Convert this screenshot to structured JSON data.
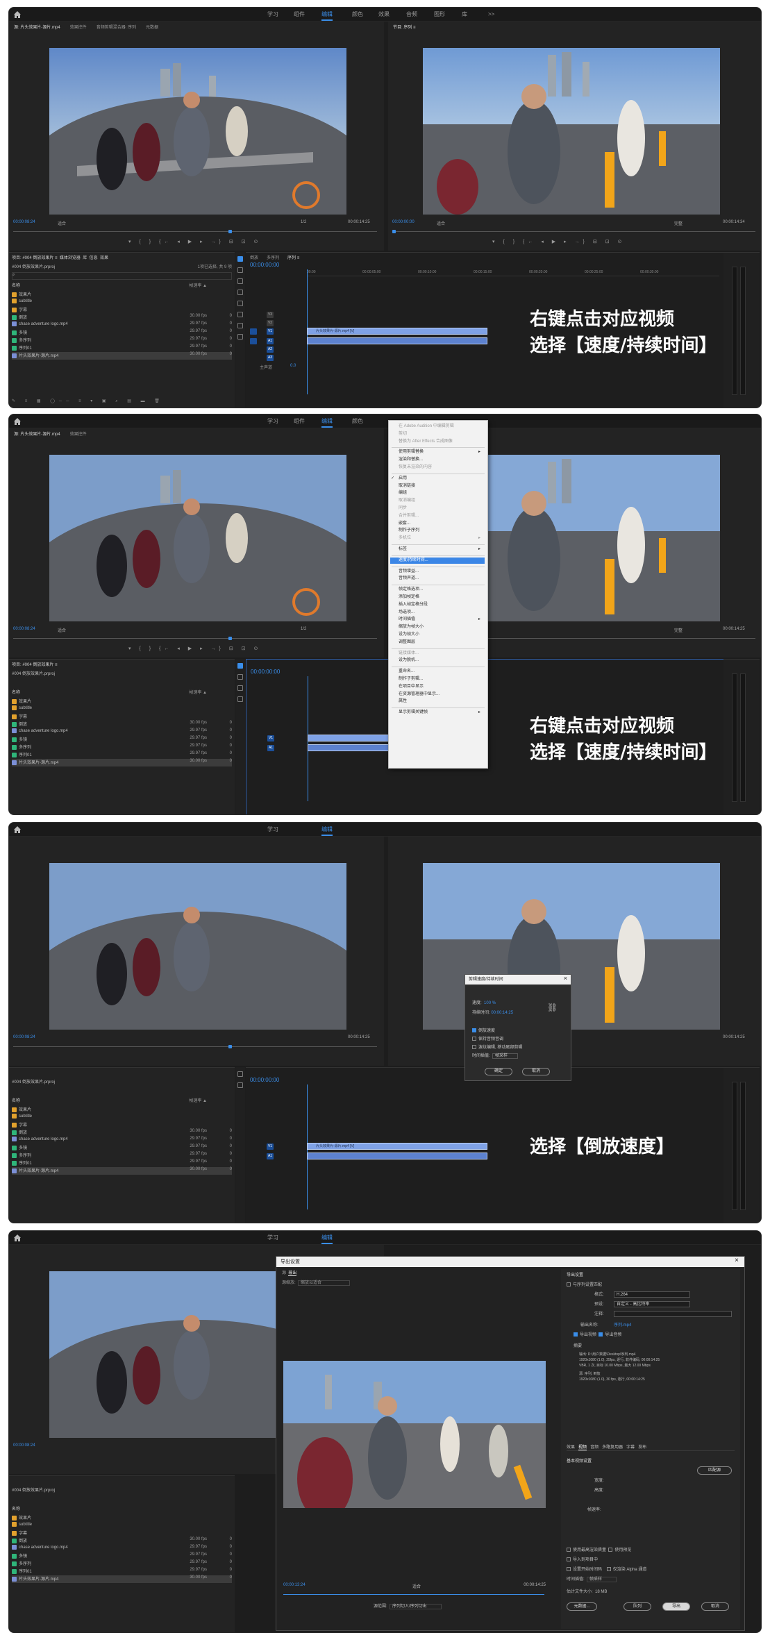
{
  "workspace_tabs": [
    "学习",
    "组件",
    "编辑",
    "颜色",
    "效果",
    "音频",
    "图形",
    "库",
    ">>"
  ],
  "active_workspace": "编辑",
  "source_monitor": {
    "tabs": [
      "源: 片头效果片-源片.mp4",
      "效果控件",
      "音频剪辑混合器: 序列",
      "元数据"
    ],
    "tc_in": "00:00:08:24",
    "fit": "适合",
    "ratio": "1/2",
    "tc_out": "00:00:14:25"
  },
  "program_monitor": {
    "tabs": [
      "节目: 序列 ≡"
    ],
    "tc_in": "00:00:00:00",
    "fit": "适合",
    "ratio": "完整",
    "tc_out": "00:00:14:34",
    "tc_out_alt": "00:00:14:25"
  },
  "project": {
    "tabs": [
      "项目: #004 倒放效果片 ≡",
      "媒体浏览器",
      "库",
      "信息",
      "效果"
    ],
    "file": "#004 倒放效果片.prproj",
    "selection": "1项已选择, 共 9 项",
    "col_name": "名称",
    "col_rate": "帧速率 ▲",
    "rows": [
      {
        "type": "folder",
        "name": "效果片",
        "rate": "",
        "val": ""
      },
      {
        "type": "folder",
        "name": "subtitle",
        "rate": "",
        "val": ""
      },
      {
        "type": "folder",
        "name": "字幕",
        "rate": "",
        "val": ""
      },
      {
        "type": "seq",
        "name": "倒放",
        "rate": "30.00 fps",
        "val": "0"
      },
      {
        "type": "clip",
        "name": "chase adventure logo.mp4",
        "rate": "29.97 fps",
        "val": "0"
      },
      {
        "type": "seq",
        "name": "多镜",
        "rate": "29.97 fps",
        "val": "0"
      },
      {
        "type": "seq",
        "name": "多序列",
        "rate": "29.97 fps",
        "val": "0"
      },
      {
        "type": "seq",
        "name": "序列01",
        "rate": "29.97 fps",
        "val": "0"
      },
      {
        "type": "clip",
        "name": "片头效果片-源片.mp4",
        "rate": "30.00 fps",
        "val": "0"
      }
    ]
  },
  "timeline": {
    "tabs": [
      "倒放",
      "多序列",
      "序列 ≡"
    ],
    "tc": "00:00:00:00",
    "ruler": [
      "00:00",
      "00:00:05:00",
      "00:00:10:00",
      "00:00:15:00",
      "00:00:20:00",
      "00:00:25:00",
      "00:00:30:00"
    ],
    "tracks": [
      "V3",
      "V2",
      "V1",
      "A1",
      "A2",
      "A3"
    ],
    "mix": "主声道",
    "mix_val": "0.0",
    "clip_label": "片头效果片-源片.mp4 [V]"
  },
  "callouts": {
    "p1_line1": "右键点击对应视频",
    "p1_line2": "选择【速度/持续时间】",
    "p2_line1": "右键点击对应视频",
    "p2_line2": "选择【速度/持续时间】",
    "p3_line1": "选择【倒放速度】"
  },
  "context_menu": [
    {
      "label": "在 Adobe Audition 中编辑剪辑",
      "dim": true
    },
    {
      "label": "剪切",
      "dim": true
    },
    {
      "label": "替换为 After Effects 合成图像",
      "dim": true
    },
    {
      "sep": true
    },
    {
      "label": "使用剪辑替换",
      "arrow": true
    },
    {
      "label": "渲染和替换...",
      "dim": false
    },
    {
      "label": "恢复未渲染的内容",
      "dim": true
    },
    {
      "sep": true
    },
    {
      "label": "启用",
      "check": true
    },
    {
      "label": "取消链接"
    },
    {
      "label": "编组"
    },
    {
      "label": "取消编组",
      "dim": true
    },
    {
      "label": "同步",
      "dim": true
    },
    {
      "label": "合并剪辑...",
      "dim": true
    },
    {
      "label": "嵌套..."
    },
    {
      "label": "制作子序列"
    },
    {
      "label": "多机位",
      "dim": true,
      "arrow": true
    },
    {
      "sep": true
    },
    {
      "label": "标签",
      "arrow": true
    },
    {
      "sep": true
    },
    {
      "label": "速度/持续时间...",
      "hl": true
    },
    {
      "sep": true
    },
    {
      "label": "音频增益..."
    },
    {
      "label": "音频声道..."
    },
    {
      "sep": true
    },
    {
      "label": "帧定格选项..."
    },
    {
      "label": "添加帧定格"
    },
    {
      "label": "插入帧定格分段"
    },
    {
      "label": "场选项..."
    },
    {
      "label": "时间插值",
      "arrow": true
    },
    {
      "label": "缩放为帧大小"
    },
    {
      "label": "设为帧大小"
    },
    {
      "label": "调整图层"
    },
    {
      "sep": true
    },
    {
      "label": "链接媒体...",
      "dim": true
    },
    {
      "label": "设为脱机..."
    },
    {
      "sep": true
    },
    {
      "label": "重命名..."
    },
    {
      "label": "制作子剪辑..."
    },
    {
      "label": "在项目中显示"
    },
    {
      "label": "在资源管理器中显示..."
    },
    {
      "label": "属性"
    },
    {
      "sep": true
    },
    {
      "label": "显示剪辑关键帧",
      "arrow": true
    }
  ],
  "speed_dialog": {
    "title": "剪辑速度/持续时间",
    "speed_label": "速度:",
    "speed_val": "100 %",
    "dur_label": "持续时间:",
    "dur_val": "00:00:14:25",
    "opt1": "倒放速度",
    "opt2": "保持音频音调",
    "opt3": "波纹编辑, 移动尾部剪辑",
    "interp_label": "时间插值:",
    "interp_val": "帧采样",
    "ok": "确定",
    "cancel": "取消"
  },
  "export_dialog": {
    "title": "导出设置",
    "tab_source": "源",
    "tab_output": "输出",
    "crop_label": "源缩放:",
    "crop_val": "缩放以适合",
    "settings_header": "导出设置",
    "match_seq": "与序列设置匹配",
    "format_label": "格式:",
    "format_val": "H.264",
    "preset_label": "预设:",
    "preset_val": "自定义 - 高比特率",
    "comment_label": "注释:",
    "output_label": "输出名称:",
    "output_val": "序列.mp4",
    "export_video": "导出视频",
    "export_audio": "导出音频",
    "summary_label": "摘要",
    "summary_out": "输出: D:\\用户数据\\Desktop\\序列.mp4",
    "summary_out2": "1920x1080 (1.0), 25fps, 逐行, 软件编码, 00:00:14:25",
    "summary_out3": "VBR, 1 次, 目标 10.00 Mbps, 最大 12.00 Mbps",
    "summary_src": "源: 序列, 倒放",
    "summary_src2": "1920x1080 (1.0), 30 fps, 逐行, 00:00:14:25",
    "tabs2": [
      "效果",
      "视频",
      "音频",
      "多路复用器",
      "字幕",
      "发布"
    ],
    "basic_video": "基本视频设置",
    "match_source": "匹配源",
    "width_label": "宽度:",
    "height_label": "高度:",
    "frame_rate_label": "帧速率:",
    "use_max": "使用最高渲染质量",
    "use_preview": "使用预览",
    "import_project": "导入到项目中",
    "set_start_tc": "设置开始时间码",
    "render_alpha": "仅渲染 Alpha 通道",
    "interp_label": "时间插值:",
    "interp_val": "帧采样",
    "file_size_label": "估计文件大小:",
    "file_size_val": "18 MB",
    "tc_left": "00:00:13:24",
    "fit": "适合",
    "tc_right": "00:00:14:25",
    "range_label": "源范围:",
    "range_val": "序列切入/序列切出",
    "btn_metadata": "元数据...",
    "btn_queue": "队列",
    "btn_export": "导出",
    "btn_cancel": "取消"
  }
}
